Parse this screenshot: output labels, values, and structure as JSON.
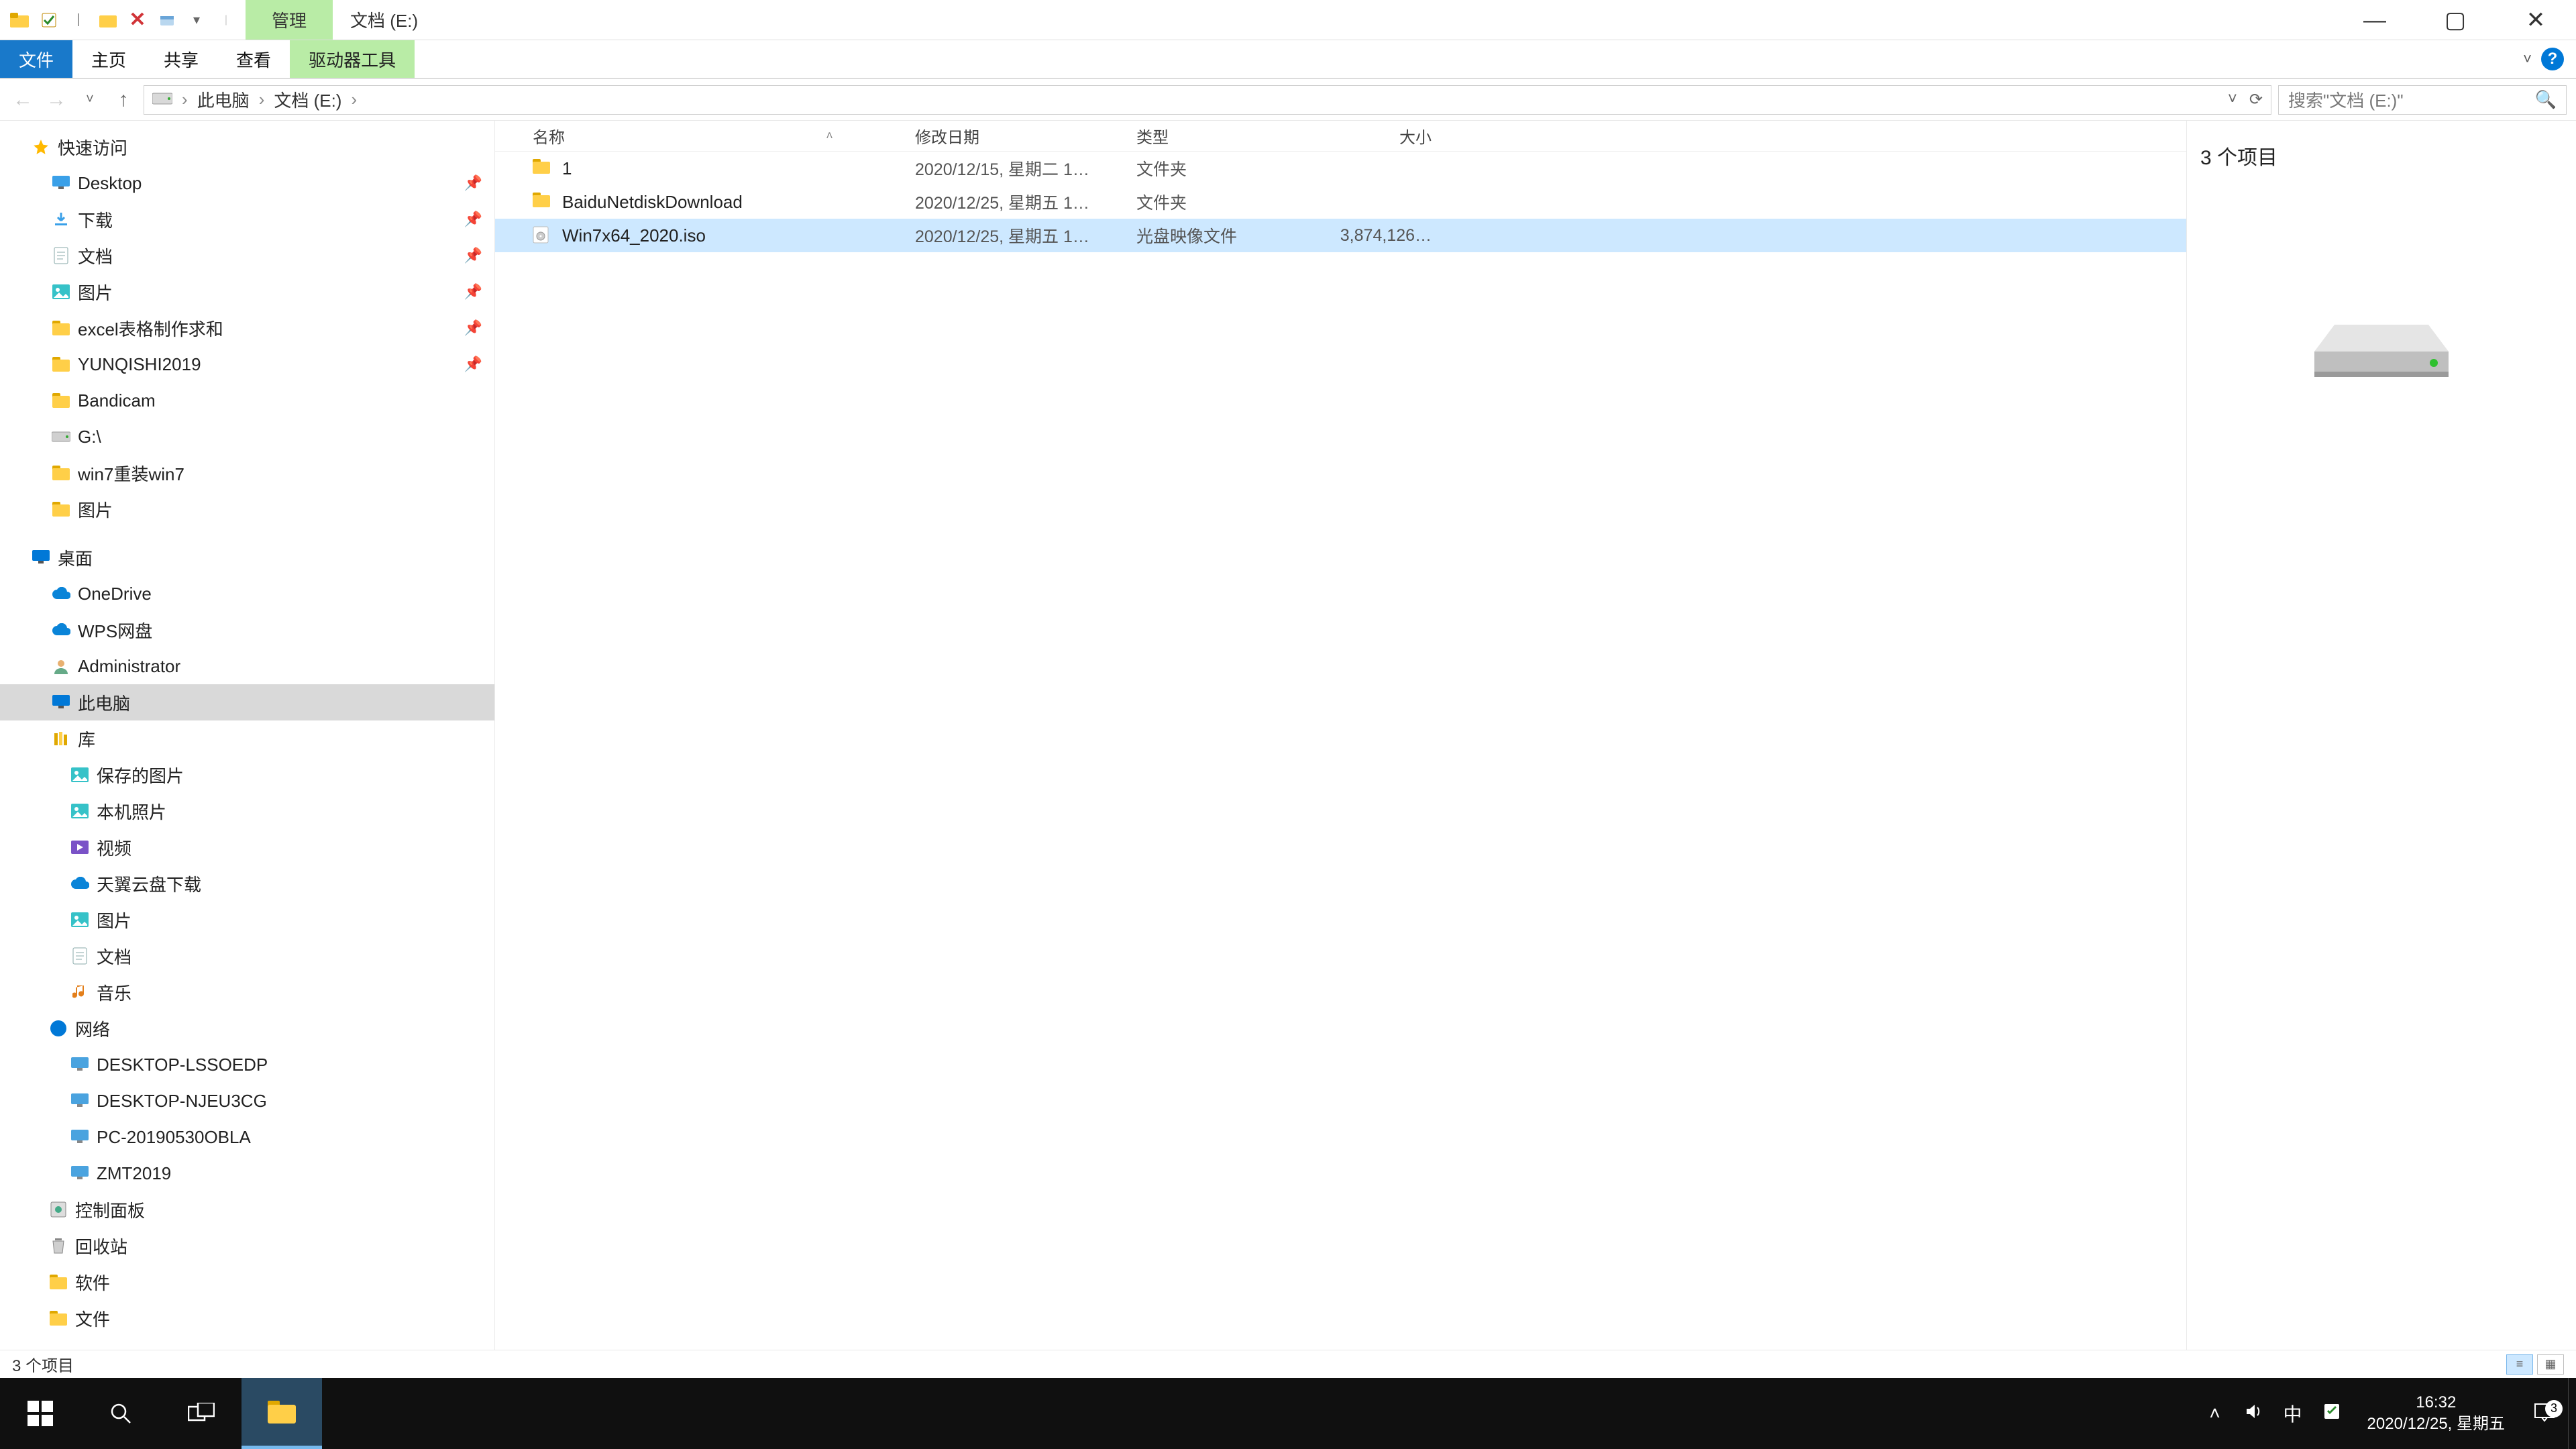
{
  "title": {
    "context_tab": "管理",
    "caption": "文档 (E:)"
  },
  "window_controls": {
    "min": "—",
    "max": "▢",
    "close": "✕"
  },
  "ribbon": {
    "file": "文件",
    "home": "主页",
    "share": "共享",
    "view": "查看",
    "drive_tools": "驱动器工具",
    "expand": "˅",
    "help": "?"
  },
  "nav": {
    "back": "←",
    "fwd": "→",
    "recent": "˅",
    "up": "↑",
    "crumbs": [
      "此电脑",
      "文档 (E:)"
    ],
    "sep": "›",
    "dropdown": "˅",
    "refresh": "⟳"
  },
  "search": {
    "placeholder": "搜索\"文档 (E:)\"",
    "icon": "🔍"
  },
  "tree": {
    "quick_access": "快速访问",
    "quick": [
      {
        "label": "Desktop",
        "icon": "desktop",
        "pinned": true
      },
      {
        "label": "下载",
        "icon": "download",
        "pinned": true
      },
      {
        "label": "文档",
        "icon": "document",
        "pinned": true
      },
      {
        "label": "图片",
        "icon": "pictures",
        "pinned": true
      },
      {
        "label": "excel表格制作求和",
        "icon": "folder",
        "pinned": true
      },
      {
        "label": "YUNQISHI2019",
        "icon": "folder",
        "pinned": true
      },
      {
        "label": "Bandicam",
        "icon": "folder",
        "pinned": false
      },
      {
        "label": "G:\\",
        "icon": "drive",
        "pinned": false
      },
      {
        "label": "win7重装win7",
        "icon": "folder",
        "pinned": false
      },
      {
        "label": "图片",
        "icon": "folder",
        "pinned": false
      }
    ],
    "desktop_root": "桌面",
    "desktop": [
      {
        "label": "OneDrive",
        "icon": "cloud"
      },
      {
        "label": "WPS网盘",
        "icon": "cloud"
      },
      {
        "label": "Administrator",
        "icon": "user"
      },
      {
        "label": "此电脑",
        "icon": "pc",
        "selected": true
      },
      {
        "label": "库",
        "icon": "library"
      }
    ],
    "libraries": [
      {
        "label": "保存的图片",
        "icon": "pictures"
      },
      {
        "label": "本机照片",
        "icon": "pictures"
      },
      {
        "label": "视频",
        "icon": "videos"
      },
      {
        "label": "天翼云盘下载",
        "icon": "cloud"
      },
      {
        "label": "图片",
        "icon": "pictures"
      },
      {
        "label": "文档",
        "icon": "document"
      },
      {
        "label": "音乐",
        "icon": "music"
      }
    ],
    "network_root": "网络",
    "network": [
      {
        "label": "DESKTOP-LSSOEDP"
      },
      {
        "label": "DESKTOP-NJEU3CG"
      },
      {
        "label": "PC-20190530OBLA"
      },
      {
        "label": "ZMT2019"
      }
    ],
    "misc": [
      {
        "label": "控制面板",
        "icon": "cp"
      },
      {
        "label": "回收站",
        "icon": "bin"
      },
      {
        "label": "软件",
        "icon": "folder"
      },
      {
        "label": "文件",
        "icon": "folder"
      }
    ]
  },
  "columns": {
    "name": "名称",
    "date": "修改日期",
    "type": "类型",
    "size": "大小"
  },
  "files": [
    {
      "name": "1",
      "date": "2020/12/15, 星期二 1…",
      "type": "文件夹",
      "size": "",
      "icon": "folder",
      "selected": false
    },
    {
      "name": "BaiduNetdiskDownload",
      "date": "2020/12/25, 星期五 1…",
      "type": "文件夹",
      "size": "",
      "icon": "folder",
      "selected": false
    },
    {
      "name": "Win7x64_2020.iso",
      "date": "2020/12/25, 星期五 1…",
      "type": "光盘映像文件",
      "size": "3,874,126…",
      "icon": "iso",
      "selected": true
    }
  ],
  "preview": {
    "count_label": "3 个项目"
  },
  "status": {
    "text": "3 个项目"
  },
  "taskbar": {
    "tray": {
      "ime": "中"
    },
    "clock": {
      "time": "16:32",
      "date": "2020/12/25, 星期五"
    },
    "notif_count": "3"
  }
}
